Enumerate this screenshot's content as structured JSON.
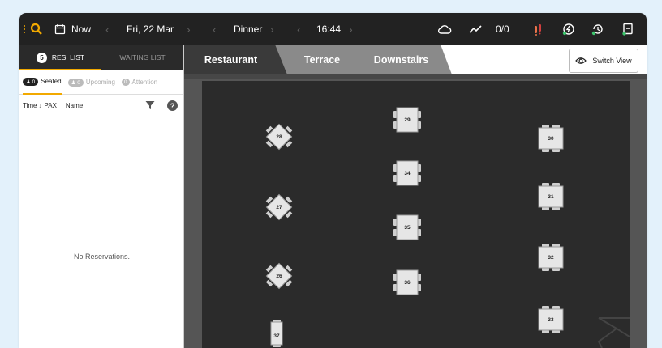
{
  "topbar": {
    "service_label": "Now",
    "date": "Fri, 22 Mar",
    "shift": "Dinner",
    "time": "16:44",
    "counter": "0/0"
  },
  "sidebar": {
    "tabs": [
      {
        "count": "5",
        "label": "RES. LIST"
      },
      {
        "label": "WAITING LIST"
      }
    ],
    "filters": [
      {
        "count": "0",
        "label": "Seated"
      },
      {
        "count": "0",
        "label": "Upcoming"
      },
      {
        "count": "0",
        "label": "Attention"
      }
    ],
    "columns": {
      "time": "Time",
      "pax": "PAX",
      "name": "Name"
    },
    "empty_text": "No Reservations."
  },
  "floor_tabs": [
    "Restaurant",
    "Terrace",
    "Downstairs"
  ],
  "switch_view_label": "Switch View",
  "tables": [
    "28",
    "27",
    "26",
    "37",
    "29",
    "34",
    "35",
    "36",
    "30",
    "31",
    "32",
    "33"
  ],
  "colors": {
    "accent": "#f2a900",
    "topbar_bg": "#222222",
    "floor_bg": "#2b2b2b",
    "active_tab_bg": "#3a3a3a",
    "inactive_tab_bg": "#8a8a8a",
    "logo_icon": "#f2a900",
    "alert_icon": "#e8734a"
  },
  "icons": [
    "more-vert-icon",
    "search-icon",
    "calendar-icon",
    "chevron-left-icon",
    "chevron-right-icon",
    "cloud-icon",
    "trend-icon",
    "walk-in-icon",
    "power-icon",
    "history-icon",
    "exit-icon",
    "filter-icon",
    "help-icon",
    "eye-icon",
    "sort-arrow-icon"
  ]
}
